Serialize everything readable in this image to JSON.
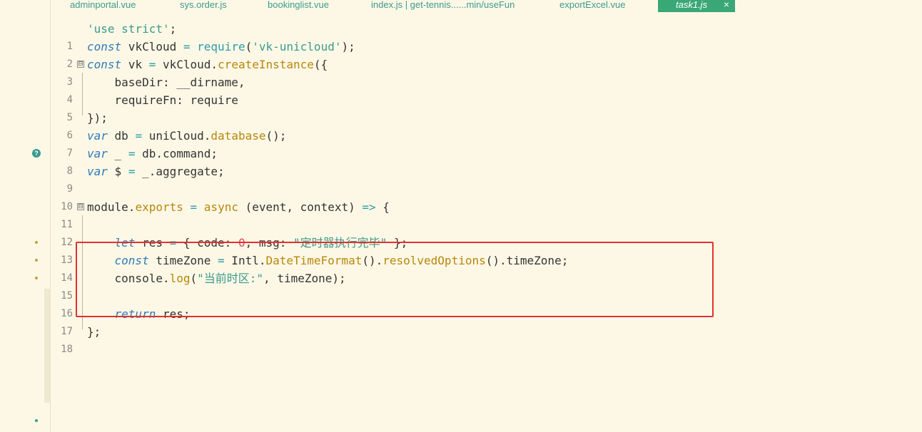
{
  "tabs": [
    {
      "label": "adminportal.vue",
      "active": false
    },
    {
      "label": "sys.order.js",
      "active": false
    },
    {
      "label": "bookinglist.vue",
      "active": false
    },
    {
      "label": "index.js | get-tennis......min/useFun",
      "active": false
    },
    {
      "label": "exportExcel.vue",
      "active": false
    },
    {
      "label": "task1.js",
      "active": true,
      "close": "×"
    }
  ],
  "line_numbers": [
    "1",
    "2",
    "3",
    "4",
    "5",
    "6",
    "7",
    "8",
    "9",
    "10",
    "11",
    "12",
    "13",
    "14",
    "15",
    "16",
    "17",
    "18"
  ],
  "fold_glyph": "⊟",
  "hint_icon": "?",
  "code": {
    "l1": [
      "'use strict'",
      ";"
    ],
    "l2": [
      "const",
      " vkCloud ",
      "=",
      " ",
      "require",
      "(",
      "'vk-unicloud'",
      ");"
    ],
    "l3": [
      "const",
      " vk ",
      "=",
      " vkCloud.",
      "createInstance",
      "({"
    ],
    "l4": [
      "    baseDir: __dirname,"
    ],
    "l5": [
      "    requireFn: require"
    ],
    "l6": [
      "});"
    ],
    "l7": [
      "var",
      " db ",
      "=",
      " uniCloud.",
      "database",
      "();"
    ],
    "l8": [
      "var",
      " _ ",
      "=",
      " db.command;"
    ],
    "l9": [
      "var",
      " $ ",
      "=",
      " _.aggregate;"
    ],
    "l11": [
      "module.",
      "exports",
      " ",
      "=",
      " ",
      "async",
      " (event, context) ",
      "=>",
      " {"
    ],
    "l13": [
      "    ",
      "let",
      " res ",
      "=",
      " { code: ",
      "0",
      ", msg: ",
      "\"定时器执行完毕\"",
      " };"
    ],
    "l14": [
      "    ",
      "const",
      " timeZone ",
      "=",
      " Intl.",
      "DateTimeFormat",
      "().",
      "resolvedOptions",
      "().timeZone;"
    ],
    "l15": [
      "    console.",
      "log",
      "(",
      "\"当前时区:\"",
      ", timeZone);"
    ],
    "l17": [
      "    ",
      "return",
      " res;"
    ],
    "l18": [
      "};"
    ]
  },
  "colors": {
    "background": "#fdf8e6",
    "keyword": "#2e7bb8",
    "string": "#3a9a8e",
    "function": "#b8860b",
    "number": "#d9466a",
    "highlight_box": "#e53030",
    "active_tab": "#3aa776"
  }
}
